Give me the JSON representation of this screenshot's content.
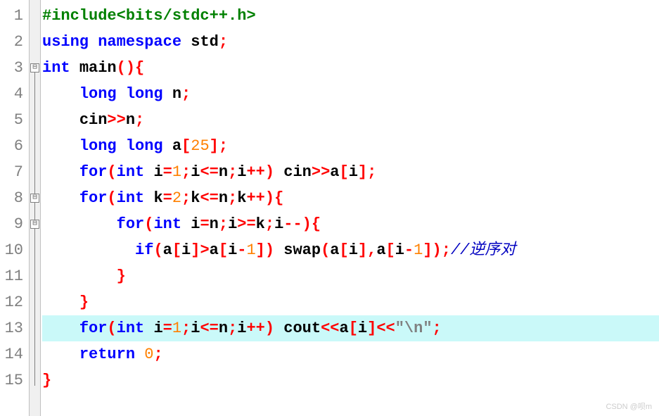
{
  "lines": [
    {
      "num": "1"
    },
    {
      "num": "2"
    },
    {
      "num": "3"
    },
    {
      "num": "4"
    },
    {
      "num": "5"
    },
    {
      "num": "6"
    },
    {
      "num": "7"
    },
    {
      "num": "8"
    },
    {
      "num": "9"
    },
    {
      "num": "10"
    },
    {
      "num": "11"
    },
    {
      "num": "12"
    },
    {
      "num": "13"
    },
    {
      "num": "14"
    },
    {
      "num": "15"
    }
  ],
  "tokens": {
    "l1_include": "#include<bits/stdc++.h>",
    "l2_using": "using",
    "l2_namespace": "namespace",
    "l2_std": "std",
    "l2_semi": ";",
    "l3_int": "int",
    "l3_main": "main",
    "l3_paren": "(){",
    "l4_long1": "long",
    "l4_long2": "long",
    "l4_n": "n",
    "l4_semi": ";",
    "l5_cin": "cin",
    "l5_op": ">>",
    "l5_n": "n",
    "l5_semi": ";",
    "l6_long1": "long",
    "l6_long2": "long",
    "l6_a": "a",
    "l6_br1": "[",
    "l6_25": "25",
    "l6_br2": "];",
    "l7_for": "for",
    "l7_p1": "(",
    "l7_int": "int",
    "l7_i": "i",
    "l7_eq": "=",
    "l7_1": "1",
    "l7_semi1": ";",
    "l7_i2": "i",
    "l7_le": "<=",
    "l7_n": "n",
    "l7_semi2": ";",
    "l7_i3": "i",
    "l7_pp": "++)",
    "l7_cin": "cin",
    "l7_op": ">>",
    "l7_a": "a",
    "l7_br1": "[",
    "l7_i4": "i",
    "l7_br2": "];",
    "l8_for": "for",
    "l8_p1": "(",
    "l8_int": "int",
    "l8_k": "k",
    "l8_eq": "=",
    "l8_2": "2",
    "l8_semi1": ";",
    "l8_k2": "k",
    "l8_le": "<=",
    "l8_n": "n",
    "l8_semi2": ";",
    "l8_k3": "k",
    "l8_pp": "++){",
    "l9_for": "for",
    "l9_p1": "(",
    "l9_int": "int",
    "l9_i": "i",
    "l9_eq": "=",
    "l9_n": "n",
    "l9_semi1": ";",
    "l9_i2": "i",
    "l9_ge": ">=",
    "l9_k": "k",
    "l9_semi2": ";",
    "l9_i3": "i",
    "l9_mm": "--){",
    "l10_if": "if",
    "l10_p1": "(",
    "l10_a": "a",
    "l10_br1": "[",
    "l10_i": "i",
    "l10_br2": "]>",
    "l10_a2": "a",
    "l10_br3": "[",
    "l10_i2": "i",
    "l10_m": "-",
    "l10_1": "1",
    "l10_br4": "])",
    "l10_swap": "swap",
    "l10_p2": "(",
    "l10_a3": "a",
    "l10_br5": "[",
    "l10_i3": "i",
    "l10_br6": "],",
    "l10_a4": "a",
    "l10_br7": "[",
    "l10_i4": "i",
    "l10_m2": "-",
    "l10_12": "1",
    "l10_br8": "]);",
    "l10_com": "//逆序对",
    "l11_br": "}",
    "l12_br": "}",
    "l13_for": "for",
    "l13_p1": "(",
    "l13_int": "int",
    "l13_i": "i",
    "l13_eq": "=",
    "l13_1": "1",
    "l13_semi1": ";",
    "l13_i2": "i",
    "l13_le": "<=",
    "l13_n": "n",
    "l13_semi2": ";",
    "l13_i3": "i",
    "l13_pp": "++)",
    "l13_cout": "cout",
    "l13_op1": "<<",
    "l13_a": "a",
    "l13_br1": "[",
    "l13_i4": "i",
    "l13_br2": "]",
    "l13_op2": "<<",
    "l13_str": "\"\\n\"",
    "l13_semi3": ";",
    "l14_return": "return",
    "l14_0": "0",
    "l14_semi": ";",
    "l15_br": "}"
  },
  "watermark": "CSDN @呗m",
  "fold_symbol": "⊟"
}
